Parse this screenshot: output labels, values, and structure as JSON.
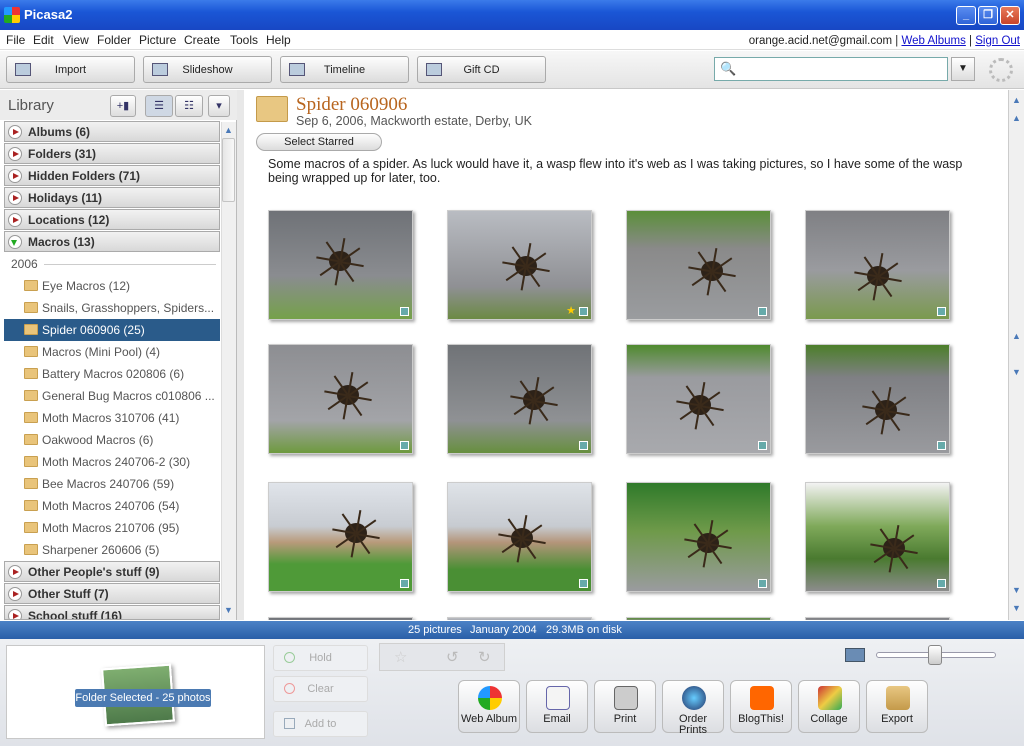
{
  "app": {
    "title": "Picasa2"
  },
  "menu": [
    "File",
    "Edit",
    "View",
    "Folder",
    "Picture",
    "Create",
    "Tools",
    "Help"
  ],
  "account": {
    "email": "orange.acid.net@gmail.com",
    "sep": "|",
    "web_albums": "Web Albums",
    "sign_out": "Sign Out"
  },
  "toolbar": {
    "import": "Import",
    "slideshow": "Slideshow",
    "timeline": "Timeline",
    "gift_cd": "Gift CD"
  },
  "library": {
    "title": "Library",
    "groups_top": [
      {
        "label": "Albums (6)"
      },
      {
        "label": "Folders (31)"
      },
      {
        "label": "Hidden Folders (71)"
      },
      {
        "label": "Holidays (11)"
      },
      {
        "label": "Locations (12)"
      },
      {
        "label": "Macros (13)"
      }
    ],
    "year": "2006",
    "folders": [
      "Eye Macros (12)",
      "Snails, Grasshoppers, Spiders...",
      "Spider 060906 (25)",
      "Macros (Mini Pool) (4)",
      "Battery Macros 020806 (6)",
      "General Bug Macros c010806 ...",
      "Moth Macros 310706 (41)",
      "Oakwood Macros (6)",
      "Moth Macros 240706-2 (30)",
      "Bee Macros 240706 (59)",
      "Moth Macros 240706 (54)",
      "Moth Macros 210706 (95)",
      "Sharpener 260606 (5)"
    ],
    "groups_bottom": [
      {
        "label": "Other People's stuff (9)"
      },
      {
        "label": "Other Stuff (7)"
      },
      {
        "label": "School stuff (16)"
      }
    ]
  },
  "folder": {
    "title": "Spider 060906",
    "subtitle": "Sep 6, 2006, Mackworth estate, Derby, UK",
    "select_starred": "Select Starred",
    "description": "Some macros of a spider.  As luck would have it, a wasp flew into it's web as I was taking pictures, so I have some of the wasp being wrapped up for later, too."
  },
  "status": {
    "count": "25 pictures",
    "date": "January 2004",
    "size": "29.3MB on disk"
  },
  "tray": {
    "selected_label": "Folder Selected - 25 photos",
    "hold": "Hold",
    "clear": "Clear",
    "add_to": "Add to"
  },
  "actions": [
    "Web Album",
    "Email",
    "Print",
    "Order Prints",
    "BlogThis!",
    "Collage",
    "Export"
  ],
  "colors": {
    "accent": "#2a5b8a",
    "folder_title": "#b8651e",
    "status_bar": "#2a5fa8"
  }
}
